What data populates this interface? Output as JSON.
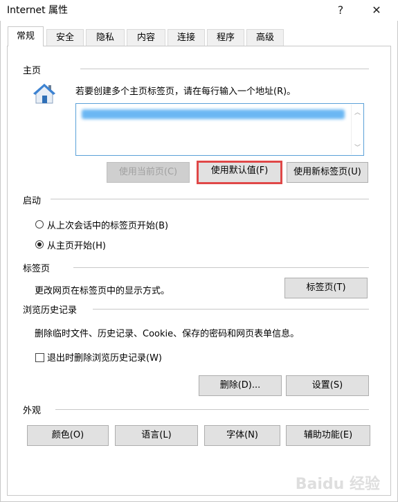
{
  "window": {
    "title": "Internet 属性",
    "help": "?",
    "close": "✕"
  },
  "tabs": [
    "常规",
    "安全",
    "隐私",
    "内容",
    "连接",
    "程序",
    "高级"
  ],
  "homepage": {
    "section_title": "主页",
    "description": "若要创建多个主页标签页，请在每行输入一个地址(R)。",
    "use_current": "使用当前页(C)",
    "use_default": "使用默认值(F)",
    "use_new_tab": "使用新标签页(U)"
  },
  "startup": {
    "section_title": "启动",
    "option_last": "从上次会话中的标签页开始(B)",
    "option_home": "从主页开始(H)",
    "selected": "option_home"
  },
  "tabs_section": {
    "section_title": "标签页",
    "description": "更改网页在标签页中的显示方式。",
    "button": "标签页(T)"
  },
  "history": {
    "section_title": "浏览历史记录",
    "description": "删除临时文件、历史记录、Cookie、保存的密码和网页表单信息。",
    "checkbox_label": "退出时删除浏览历史记录(W)",
    "delete_button": "删除(D)...",
    "settings_button": "设置(S)"
  },
  "appearance": {
    "section_title": "外观",
    "colors": "颜色(O)",
    "languages": "语言(L)",
    "fonts": "字体(N)",
    "accessibility": "辅助功能(E)"
  },
  "watermark": "Baidu 经验",
  "colors": {
    "highlight": "#e04848",
    "url_blur": "#3aa0f0",
    "textarea_border": "#5aa0d8"
  }
}
